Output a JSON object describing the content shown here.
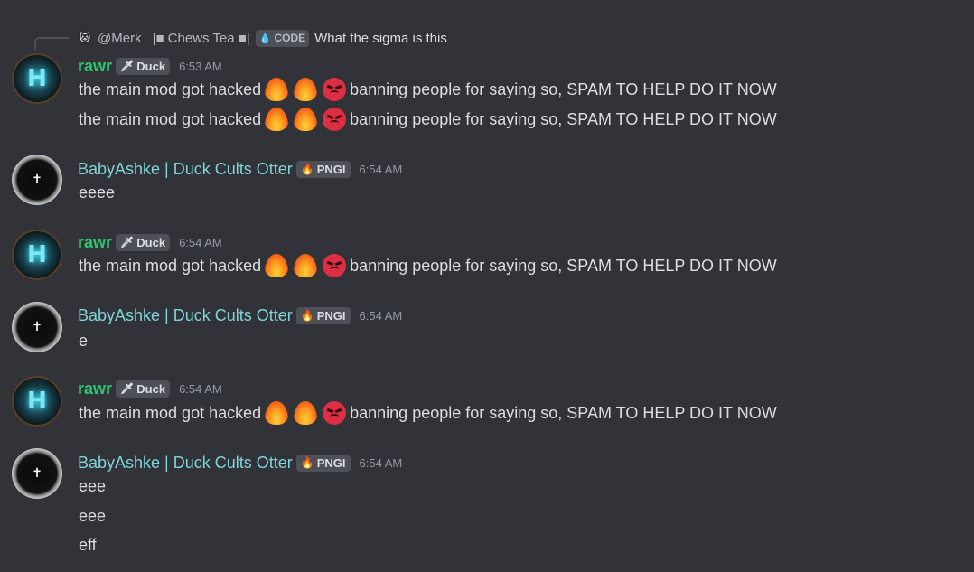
{
  "reply": {
    "author": "@Merk",
    "tag": "|■ Chews Tea ■|",
    "badge": "CODE",
    "text": "What the sigma is this"
  },
  "icons": {
    "fire": "fire-emoji",
    "angry": "angry-face-emoji"
  },
  "colors": {
    "background": "#313338",
    "rawr_name": "#2dc770",
    "baby_name": "#7fd4d9",
    "badge_bg": "#4e5058"
  },
  "messages": [
    {
      "author": "rawr",
      "badge": "Duck",
      "time": "6:53 AM",
      "lines": [
        {
          "a": "the main mod got hacked",
          "b": "banning people for saying so, SPAM TO HELP  DO IT NOW"
        },
        {
          "a": "the main mod got hacked",
          "b": "banning people for saying so, SPAM TO HELP  DO IT NOW"
        }
      ]
    },
    {
      "author": "BabyAshke | Duck Cults Otter",
      "badge": "PNGI",
      "time": "6:54 AM",
      "lines": [
        "eeee"
      ]
    },
    {
      "author": "rawr",
      "badge": "Duck",
      "time": "6:54 AM",
      "lines": [
        {
          "a": "the main mod got hacked",
          "b": "banning people for saying so, SPAM TO HELP  DO IT NOW"
        }
      ]
    },
    {
      "author": "BabyAshke | Duck Cults Otter",
      "badge": "PNGI",
      "time": "6:54 AM",
      "lines": [
        "e"
      ]
    },
    {
      "author": "rawr",
      "badge": "Duck",
      "time": "6:54 AM",
      "lines": [
        {
          "a": "the main mod got hacked",
          "b": "banning people for saying so, SPAM TO HELP  DO IT NOW"
        }
      ]
    },
    {
      "author": "BabyAshke | Duck Cults Otter",
      "badge": "PNGI",
      "time": "6:54 AM",
      "lines": [
        "eee",
        "eee",
        "eff"
      ]
    }
  ]
}
